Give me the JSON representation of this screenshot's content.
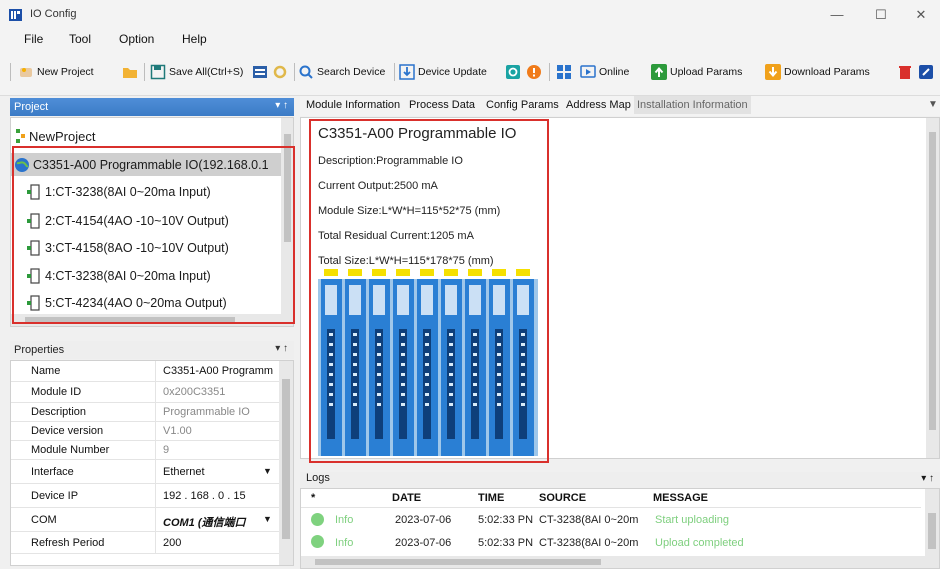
{
  "window": {
    "title": "IO Config",
    "minimize": "—",
    "maximize": "☐",
    "close": "✕"
  },
  "menu": [
    "File",
    "Tool",
    "Option",
    "Help"
  ],
  "toolbar": {
    "new_project": "New Project",
    "save_all": "Save All(Ctrl+S)",
    "search_device": "Search Device",
    "device_update": "Device Update",
    "online": "Online",
    "upload_params": "Upload Params",
    "download_params": "Download Params"
  },
  "project": {
    "header": "Project",
    "pin": "▾ ↑",
    "root": "NewProject",
    "device": "C3351-A00 Programmable IO(192.168.0.1",
    "modules": [
      "1:CT-3238(8AI 0~20ma Input)",
      "2:CT-4154(4AO -10~10V Output)",
      "3:CT-4158(8AO -10~10V Output)",
      "4:CT-3238(8AI 0~20ma Input)",
      "5:CT-4234(4AO 0~20ma Output)"
    ]
  },
  "properties": {
    "header": "Properties",
    "rows": [
      {
        "key": "Name",
        "value": "C3351-A00 Programm"
      },
      {
        "key": "Module ID",
        "value": "0x200C3351"
      },
      {
        "key": "Description",
        "value": "Programmable IO"
      },
      {
        "key": "Device version",
        "value": "V1.00"
      },
      {
        "key": "Module Number",
        "value": "9"
      },
      {
        "key": "Interface",
        "value": "Ethernet"
      },
      {
        "key": "Device IP",
        "value": "192 . 168 .  0  . 15"
      },
      {
        "key": "COM",
        "value": "COM1 (通信端口"
      },
      {
        "key": "Refresh Period",
        "value": "200"
      }
    ]
  },
  "tabs": [
    "Module Information",
    "Process Data",
    "Config Params",
    "Address Map",
    "Installation Information"
  ],
  "module_info": {
    "title": "C3351-A00 Programmable IO",
    "description": "Description:Programmable IO",
    "current_output": "Current Output:2500 mA",
    "module_size": "Module Size:L*W*H=115*52*75 (mm)",
    "residual_current": "Total Residual Current:1205 mA",
    "total_size": "Total Size:L*W*H=115*178*75 (mm)"
  },
  "logs": {
    "header": "Logs",
    "columns": [
      "*",
      "DATE",
      "TIME",
      "SOURCE",
      "MESSAGE"
    ],
    "rows": [
      {
        "level": "Info",
        "date": "2023-07-06",
        "time": "5:02:33 PN",
        "source": "CT-3238(8AI 0~20m",
        "message": "Start uploading"
      },
      {
        "level": "Info",
        "date": "2023-07-06",
        "time": "5:02:33 PN",
        "source": "CT-3238(8AI 0~20m",
        "message": "Upload completed"
      }
    ]
  },
  "colors": {
    "accent": "#3b7bc6",
    "highlight": "#d9302c",
    "info_green": "#7fd27f",
    "module_blue": "#2a7fd4"
  }
}
